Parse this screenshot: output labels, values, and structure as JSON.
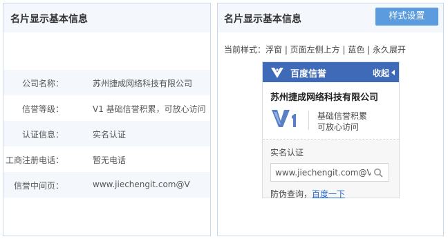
{
  "left_panel": {
    "title": "名片显示基本信息",
    "rows": [
      {
        "label": "公司名称：",
        "value": "苏州捷成网络科技有限公司"
      },
      {
        "label": "信誉等级：",
        "value": "V1  基础信誉积累，可放心访问"
      },
      {
        "label": "认证信息：",
        "value": "实名认证"
      },
      {
        "label": "工商注册电话：",
        "value": "暂无电话"
      },
      {
        "label": "信誉中间页：",
        "value": "www.jiechengit.com@V"
      }
    ]
  },
  "right_panel": {
    "title": "名片显示基本信息",
    "style_button": "样式设置",
    "current_style": "当前样式：浮窗 | 页面左侧上方 | 蓝色 | 永久展开",
    "card": {
      "brand": "百度信誉",
      "collapse": "收起",
      "company": "苏州捷成网络科技有限公司",
      "level_line1": "基础信誉积累",
      "level_line2": "可放心访问",
      "verified": "实名认证",
      "url_value": "www.jiechengit.com@V",
      "anti_fake_label": "防伪查询，",
      "anti_fake_link": "百度一下"
    }
  },
  "colors": {
    "accent_blue": "#3f6ab8",
    "button_blue": "#5c9bde",
    "link_blue": "#2a6acb",
    "header_bg": "#f4f8fc"
  },
  "icons": [
    "baidu-credit-logo-icon",
    "collapse-arrow-icon",
    "v1-badge-icon",
    "search-icon"
  ]
}
